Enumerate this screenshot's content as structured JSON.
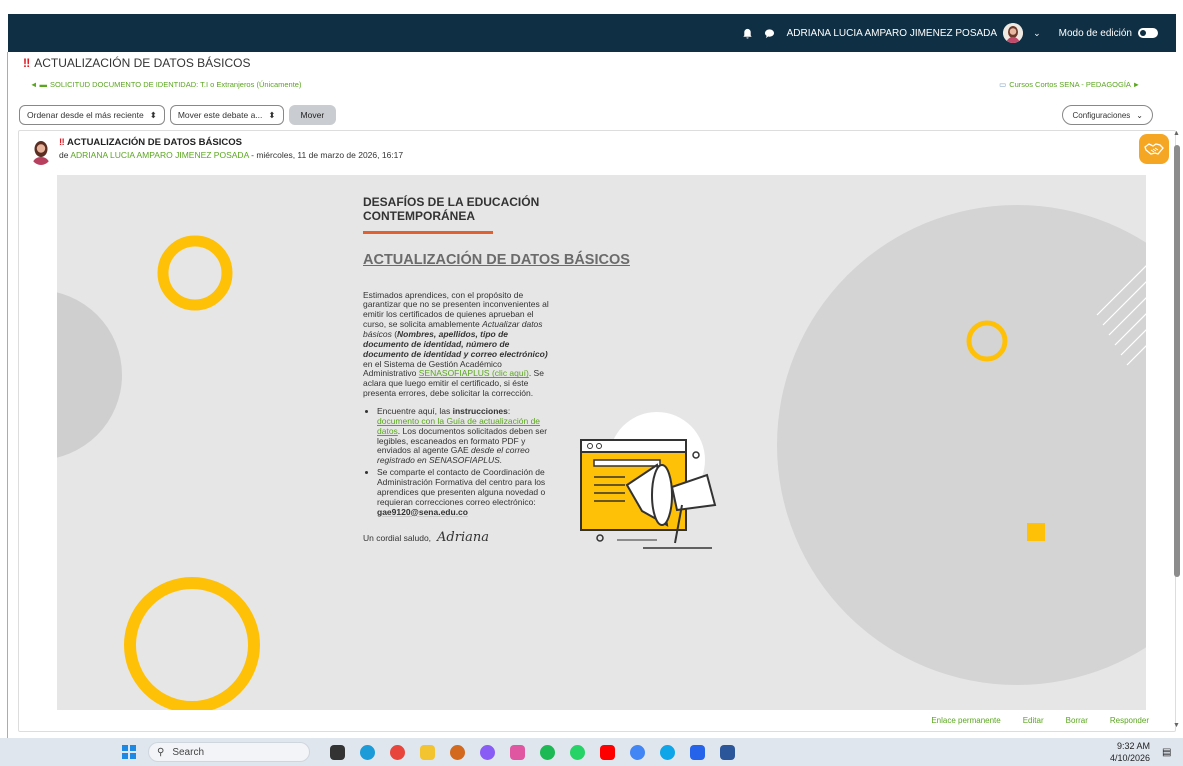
{
  "topbar": {
    "user_name": "ADRIANA LUCIA AMPARO JIMENEZ POSADA",
    "edit_mode_label": "Modo de edición",
    "bell_icon": "bell-icon",
    "chat_icon": "chat-icon"
  },
  "page": {
    "title": "ACTUALIZACIÓN DE DATOS BÁSICOS",
    "prev_link": "SOLICITUD DOCUMENTO DE IDENTIDAD: T.I o Extranjeros (Únicamente)",
    "next_link": "Cursos Cortos SENA - PEDAGOGÍA ►"
  },
  "controls": {
    "sort_select": "Ordenar desde el más reciente",
    "move_select": "Mover este debate a...",
    "move_button": "Mover",
    "settings_button": "Configuraciones"
  },
  "post": {
    "title": "ACTUALIZACIÓN DE DATOS BÁSICOS",
    "by_prefix": "de",
    "author": "ADRIANA LUCIA AMPARO JIMENEZ POSADA",
    "date": "- miércoles, 11 de marzo de 2026, 16:17",
    "footer": {
      "permalink": "Enlace permanente",
      "edit": "Editar",
      "delete": "Borrar",
      "reply": "Responder"
    }
  },
  "banner": {
    "heading": "DESAFÍOS DE LA EDUCACIÓN CONTEMPORÁNEA",
    "main_title": "ACTUALIZACIÓN DE DATOS BÁSICOS",
    "p1_a": "Estimados aprendices, con el propósito de garantizar que no se presenten inconvenientes al emitir los certificados de quienes aprueban el curso, se solicita amablemente ",
    "p1_italic": "Actualizar datos básicos",
    "p1_b": " (",
    "p1_bold": "Nombres, apellidos, tipo de documento de identidad, número de documento de identidad y correo electrónico)",
    "p1_c": " en el Sistema de Gestión Académico Administrativo ",
    "p1_link": "SENASOFIAPLUS (clic aquí)",
    "p1_d": ". Se aclara que luego emitir el certificado, si éste presenta errores, debe solicitar la corrección.",
    "li1_a": "Encuentre aquí, las ",
    "li1_bold": "instrucciones",
    "li1_b": ": ",
    "li1_link": "documento con la Guía de actualización de datos",
    "li1_c": ". Los documentos solicitados deben ser legibles, escaneados en formato PDF y enviados al agente GAE ",
    "li1_italic": "desde el correo registrado en SENASOFIAPLUS.",
    "li2_a": "Se comparte el contacto de Coordinación de Administración Formativa del centro para los aprendices que presenten alguna novedad o requieran correcciones correo electrónico: ",
    "li2_email": "gae9120@sena.edu.co",
    "closing": "Un cordial saludo,",
    "signature": "Adriana"
  },
  "taskbar": {
    "search_placeholder": "Search",
    "time": "9:32 AM",
    "date": "4/10/2026"
  },
  "colors": {
    "topbar": "#0f2f44",
    "accent_green": "#5aa61e",
    "yellow": "#ffc107",
    "orange": "#f5a623"
  }
}
